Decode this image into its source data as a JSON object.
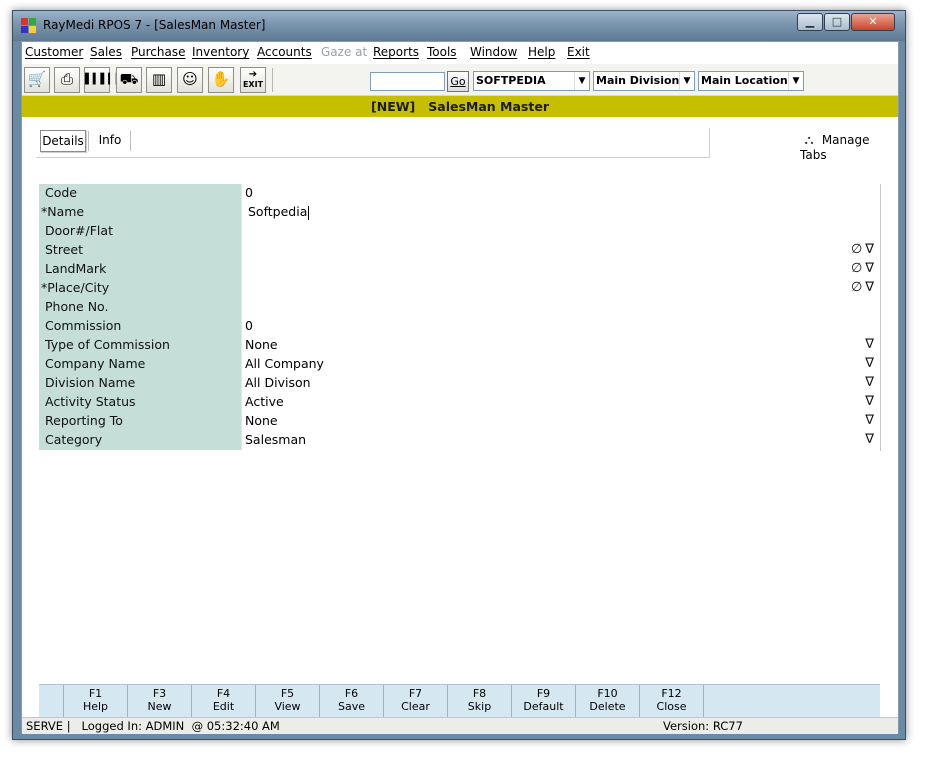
{
  "window": {
    "title": "RayMedi RPOS 7 - [SalesMan Master]"
  },
  "menu": [
    {
      "label": "Customer",
      "disabled": false
    },
    {
      "label": "Sales",
      "disabled": false
    },
    {
      "label": "Purchase",
      "disabled": false
    },
    {
      "label": "Inventory",
      "disabled": false
    },
    {
      "label": "Accounts",
      "disabled": false
    },
    {
      "label": "Gaze at",
      "disabled": true
    },
    {
      "label": "Reports",
      "disabled": false
    },
    {
      "label": "Tools",
      "disabled": false
    },
    {
      "label": "Window",
      "disabled": false
    },
    {
      "label": "Help",
      "disabled": false
    },
    {
      "label": "Exit",
      "disabled": false
    }
  ],
  "toolbar": {
    "buttons": [
      {
        "icon": "shopping-cart-icon"
      },
      {
        "icon": "printer-icon"
      },
      {
        "icon": "barcode-icon"
      },
      {
        "icon": "basket-icon"
      },
      {
        "icon": "books-icon"
      },
      {
        "icon": "users-icon"
      },
      {
        "icon": "hand-box-icon"
      }
    ],
    "exit_label": "EXIT",
    "search_value": "",
    "go_label": "Go",
    "company_value": "SOFTPEDIA",
    "division_value": "Main Division",
    "location_value": "Main Location"
  },
  "banner": {
    "text": "[NEW]   SalesMan Master"
  },
  "tabs": [
    {
      "label": "Details",
      "active": true
    },
    {
      "label": "Info",
      "active": false
    }
  ],
  "manage_tabs_label": "Manage Tabs",
  "form": {
    "rows": [
      {
        "label": "Code",
        "value": "0",
        "icons": ""
      },
      {
        "label": "*Name",
        "value": "Softpedia",
        "icons": ""
      },
      {
        "label": "Door#/Flat",
        "value": "",
        "icons": ""
      },
      {
        "label": "Street",
        "value": "",
        "icons": "∅∇"
      },
      {
        "label": "LandMark",
        "value": "",
        "icons": "∅∇"
      },
      {
        "label": "*Place/City",
        "value": "",
        "icons": "∅∇"
      },
      {
        "label": "Phone No.",
        "value": "",
        "icons": ""
      },
      {
        "label": "Commission",
        "value": "0",
        "icons": ""
      },
      {
        "label": "Type of Commission",
        "value": "None",
        "icons": "∇"
      },
      {
        "label": "Company Name",
        "value": "All Company",
        "icons": "∇"
      },
      {
        "label": "Division Name",
        "value": "All Divison",
        "icons": "∇"
      },
      {
        "label": "Activity Status",
        "value": "Active",
        "icons": "∇"
      },
      {
        "label": "Reporting To",
        "value": "None",
        "icons": "∇"
      },
      {
        "label": "Category",
        "value": "Salesman",
        "icons": "∇"
      }
    ]
  },
  "fkeys": [
    {
      "key": "F1",
      "label": "Help"
    },
    {
      "key": "F3",
      "label": "New"
    },
    {
      "key": "F4",
      "label": "Edit"
    },
    {
      "key": "F5",
      "label": "View"
    },
    {
      "key": "F6",
      "label": "Save"
    },
    {
      "key": "F7",
      "label": "Clear"
    },
    {
      "key": "F8",
      "label": "Skip"
    },
    {
      "key": "F9",
      "label": "Default"
    },
    {
      "key": "F10",
      "label": "Delete"
    },
    {
      "key": "F12",
      "label": "Close"
    }
  ],
  "status": {
    "left": "SERVE |   Logged In: ADMIN  @ 05:32:40 AM",
    "version": "Version: RC77"
  },
  "colors": {
    "banner": "#c5bf00",
    "label_bg": "#c5dfd8",
    "fkey_bg": "#d5e7f1"
  }
}
